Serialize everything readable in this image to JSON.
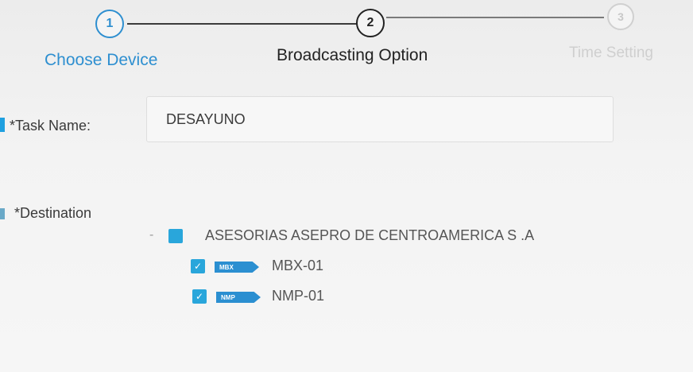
{
  "stepper": {
    "steps": [
      {
        "number": "1",
        "label": "Choose Device"
      },
      {
        "number": "2",
        "label": "Broadcasting Option"
      },
      {
        "number": "3",
        "label": "Time Setting"
      }
    ]
  },
  "form": {
    "task_name_label": "*Task Name:",
    "task_name_value": "DESAYUNO",
    "destination_label": "*Destination"
  },
  "tree": {
    "expander": "-",
    "root_label": "ASESORIAS ASEPRO DE CENTROAMERICA S .A",
    "devices": [
      {
        "badge": "MBX",
        "name": "MBX-01"
      },
      {
        "badge": "NMP",
        "name": "NMP-01"
      }
    ]
  },
  "colors": {
    "accent": "#1fa0e0",
    "step_active_text": "#222222",
    "step_done_text": "#2e8fd0",
    "step_pending_text": "#c8c8c8"
  }
}
